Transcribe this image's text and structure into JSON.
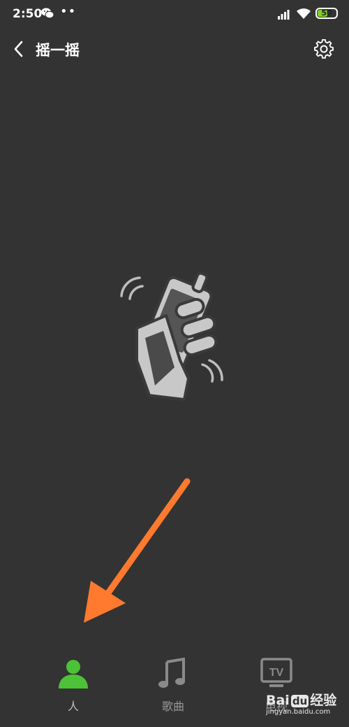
{
  "status_bar": {
    "time": "2:50",
    "dots": "••",
    "battery_level": "50"
  },
  "header": {
    "title": "摇一摇"
  },
  "tabs": [
    {
      "label": "人",
      "icon": "person-icon",
      "active": true
    },
    {
      "label": "歌曲",
      "icon": "music-note-icon",
      "active": false
    },
    {
      "label": "电视",
      "icon": "tv-icon",
      "active": false
    }
  ],
  "watermark": {
    "brand_left": "Bai",
    "brand_mid": "du",
    "brand_right": "经验",
    "url": "jingyan.baidu.com"
  },
  "colors": {
    "background": "#333333",
    "active_tab": "#4cc236",
    "inactive_icon": "#8a8a8a",
    "annotation_arrow": "#ff7a2e"
  }
}
